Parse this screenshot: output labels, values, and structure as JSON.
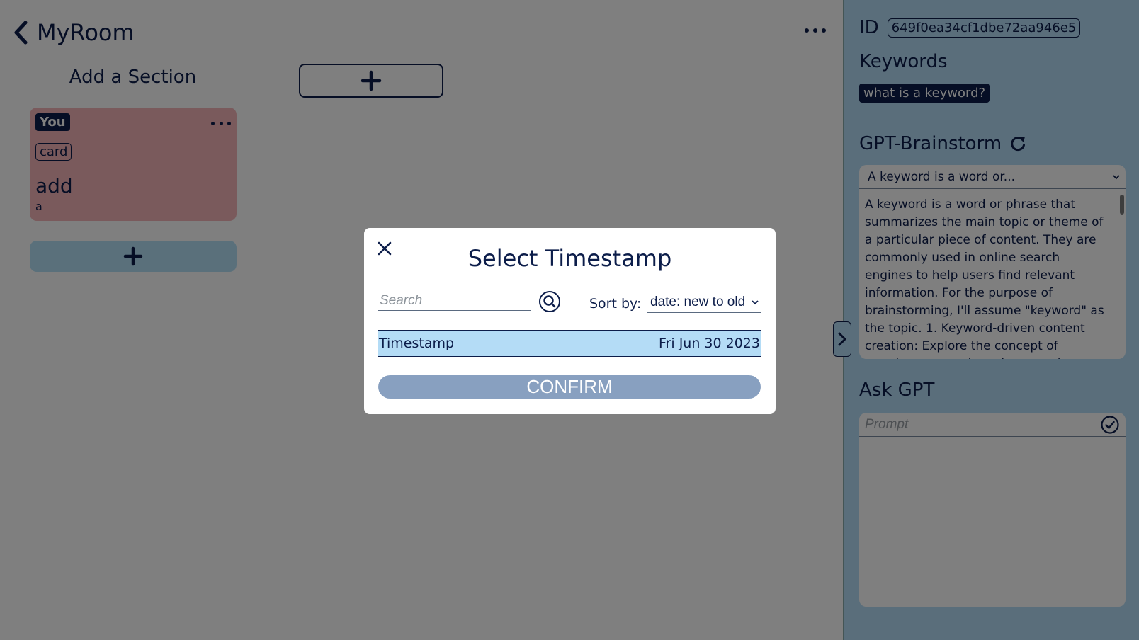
{
  "header": {
    "title": "MyRoom"
  },
  "left_column": {
    "title": "Add a Section",
    "card": {
      "badge": "You",
      "tag": "card",
      "title": "add",
      "subtitle": "a"
    }
  },
  "panel": {
    "id_label": "ID",
    "id_value": "649f0ea34cf1dbe72aa946e5",
    "keywords_heading": "Keywords",
    "keyword_chip": "what is a keyword?",
    "brainstorm_heading": "GPT-Brainstorm",
    "brainstorm_selected": "A keyword is a word or...",
    "brainstorm_text": "A keyword is a word or phrase that summarizes the main topic or theme of a particular piece of content. They are commonly used in online search engines to help users find relevant information. For the purpose of brainstorming, I'll assume \"keyword\" as the topic. 1. Keyword-driven content creation: Explore the concept of creating content based on popular",
    "ask_heading": "Ask GPT",
    "ask_placeholder": "Prompt"
  },
  "modal": {
    "title": "Select Timestamp",
    "search_placeholder": "Search",
    "sort_label": "Sort by:",
    "sort_value": "date: new to old",
    "rows": [
      {
        "label": "Timestamp",
        "date": "Fri Jun 30 2023"
      }
    ],
    "confirm_label": "CONFIRM"
  },
  "icons": {
    "back": "chevron-left-icon",
    "more": "more-horizontal-icon",
    "plus": "plus-icon",
    "refresh": "refresh-icon",
    "check": "check-circle-icon",
    "close": "close-icon",
    "search": "search-icon",
    "expand": "chevron-right-icon"
  },
  "colors": {
    "primary": "#0c1d4a",
    "card_background": "#f4b4b8",
    "panel_background": "#b4dcf6",
    "confirm_button": "#88a0c0",
    "overlay": "rgba(0,0,0,0.5)"
  }
}
